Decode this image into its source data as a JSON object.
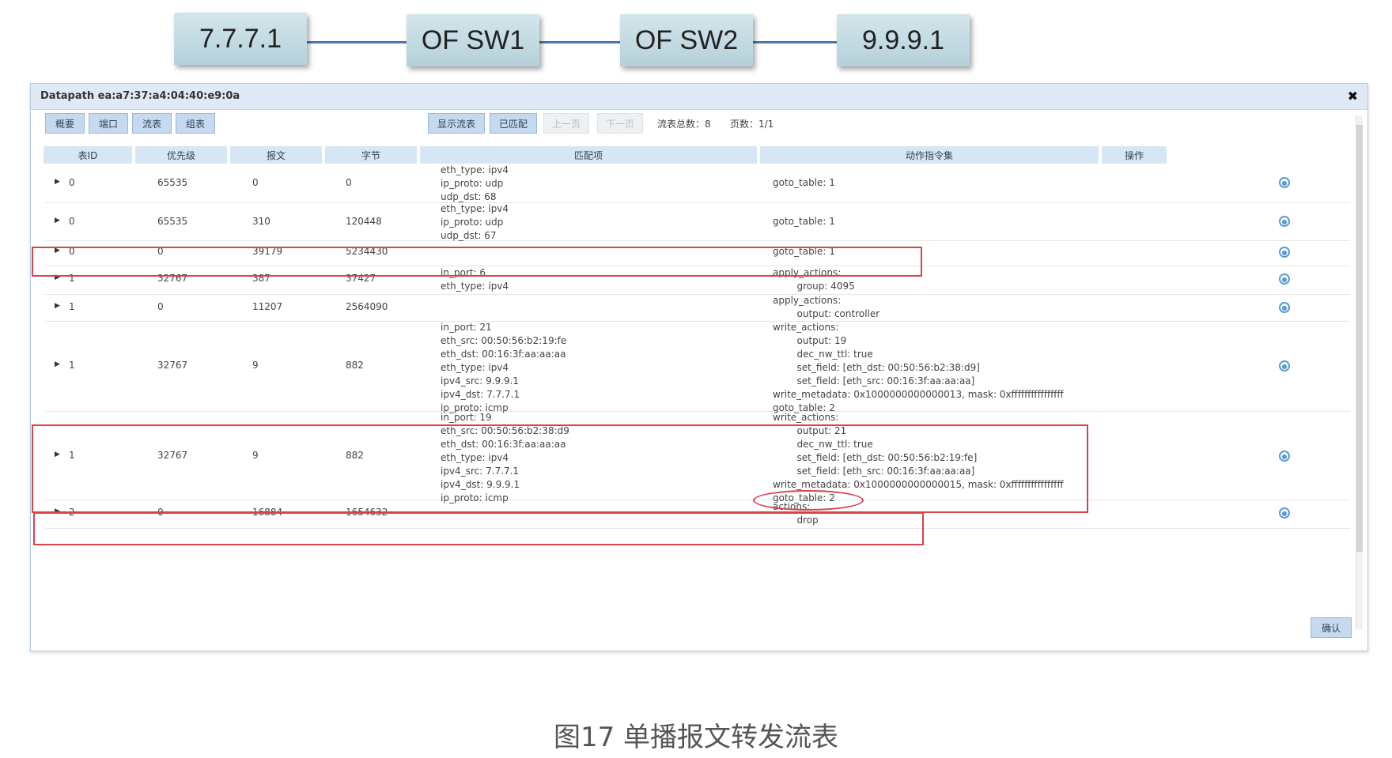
{
  "topology": {
    "nodes": [
      "7.7.7.1",
      "OF SW1",
      "OF SW2",
      "9.9.9.1"
    ]
  },
  "dialog": {
    "title": "Datapath ea:a7:37:a4:04:40:e9:0a",
    "close_glyph": "✖",
    "tabs": [
      "概要",
      "端口",
      "流表",
      "组表"
    ],
    "buttons": [
      "显示流表",
      "已匹配",
      "上一页",
      "下一页"
    ],
    "flow_count_label": "流表总数：8",
    "page_label": "页数：1/1",
    "columns": [
      "表ID",
      "优先级",
      "报文",
      "字节",
      "匹配项",
      "动作指令集",
      "操作"
    ],
    "rows": [
      {
        "table": "0",
        "priority": "65535",
        "packets": "0",
        "bytes": "0",
        "match": "eth_type: ipv4\nip_proto: udp\nudp_dst: 68",
        "actions": "goto_table: 1"
      },
      {
        "table": "0",
        "priority": "65535",
        "packets": "310",
        "bytes": "120448",
        "match": "eth_type: ipv4\nip_proto: udp\nudp_dst: 67",
        "actions": "goto_table: 1"
      },
      {
        "table": "0",
        "priority": "0",
        "packets": "39179",
        "bytes": "5234430",
        "match": "",
        "actions": "goto_table: 1"
      },
      {
        "table": "1",
        "priority": "32767",
        "packets": "387",
        "bytes": "37427",
        "match": "in_port: 6\neth_type: ipv4",
        "actions": "apply_actions:\n        group: 4095"
      },
      {
        "table": "1",
        "priority": "0",
        "packets": "11207",
        "bytes": "2564090",
        "match": "",
        "actions": "apply_actions:\n        output: controller"
      },
      {
        "table": "1",
        "priority": "32767",
        "packets": "9",
        "bytes": "882",
        "match": "in_port: 21\neth_src: 00:50:56:b2:19:fe\neth_dst: 00:16:3f:aa:aa:aa\neth_type: ipv4\nipv4_src: 9.9.9.1\nipv4_dst: 7.7.7.1\nip_proto: icmp",
        "actions": "write_actions:\n        output: 19\n        dec_nw_ttl: true\n        set_field: [eth_dst: 00:50:56:b2:38:d9]\n        set_field: [eth_src: 00:16:3f:aa:aa:aa]\nwrite_metadata: 0x1000000000000013, mask: 0xffffffffffffffff\ngoto_table: 2"
      },
      {
        "table": "1",
        "priority": "32767",
        "packets": "9",
        "bytes": "882",
        "match": "in_port: 19\neth_src: 00:50:56:b2:38:d9\neth_dst: 00:16:3f:aa:aa:aa\neth_type: ipv4\nipv4_src: 7.7.7.1\nipv4_dst: 9.9.9.1\nip_proto: icmp",
        "actions": "write_actions:\n        output: 21\n        dec_nw_ttl: true\n        set_field: [eth_dst: 00:50:56:b2:19:fe]\n        set_field: [eth_src: 00:16:3f:aa:aa:aa]\nwrite_metadata: 0x1000000000000015, mask: 0xffffffffffffffff\ngoto_table: 2"
      },
      {
        "table": "2",
        "priority": "0",
        "packets": "16884",
        "bytes": "1654632",
        "match": "",
        "actions": "actions:\n        drop"
      }
    ],
    "confirm_label": "确认"
  },
  "caption": "图17 单播报文转发流表"
}
